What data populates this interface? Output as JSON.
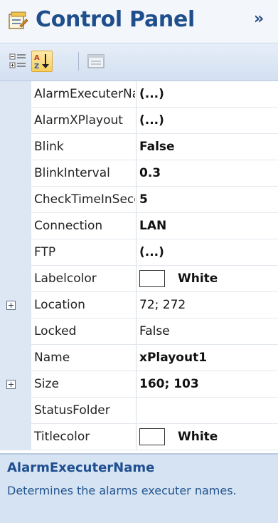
{
  "title_bar": {
    "title": "Control Panel",
    "icon": "control-panel-icon",
    "overflow_icon": "chevron-double-right-icon"
  },
  "toolbar": {
    "buttons": [
      {
        "icon": "categorized-icon",
        "active": false
      },
      {
        "icon": "alphabetical-sort-icon",
        "active": true
      },
      {
        "icon": "property-pages-icon",
        "active": false
      }
    ]
  },
  "properties": [
    {
      "name": "AlarmExecuterName",
      "value": "(...)",
      "bold": true,
      "expandable": false
    },
    {
      "name": "AlarmXPlayout",
      "value": "(...)",
      "bold": true,
      "expandable": false
    },
    {
      "name": "Blink",
      "value": "False",
      "bold": true,
      "expandable": false
    },
    {
      "name": "BlinkInterval",
      "value": "0.3",
      "bold": true,
      "expandable": false
    },
    {
      "name": "CheckTimeInSeconds",
      "value": "5",
      "bold": true,
      "expandable": false
    },
    {
      "name": "Connection",
      "value": "LAN",
      "bold": true,
      "expandable": false
    },
    {
      "name": "FTP",
      "value": "(...)",
      "bold": true,
      "expandable": false
    },
    {
      "name": "Labelcolor",
      "value": "White",
      "bold": true,
      "expandable": false,
      "swatch": "#ffffff"
    },
    {
      "name": "Location",
      "value": "72; 272",
      "bold": false,
      "expandable": true
    },
    {
      "name": "Locked",
      "value": "False",
      "bold": false,
      "expandable": false
    },
    {
      "name": "Name",
      "value": "xPlayout1",
      "bold": true,
      "expandable": false
    },
    {
      "name": "Size",
      "value": "160; 103",
      "bold": true,
      "expandable": true
    },
    {
      "name": "StatusFolder",
      "value": "",
      "bold": false,
      "expandable": false
    },
    {
      "name": "Titlecolor",
      "value": "White",
      "bold": true,
      "expandable": false,
      "swatch": "#ffffff"
    }
  ],
  "description": {
    "title": "AlarmExecuterName",
    "text": "Determines the alarms executer names."
  },
  "colors": {
    "title": "#1e4e8c",
    "description_text": "#23558f",
    "gutter": "#dde7f4"
  }
}
